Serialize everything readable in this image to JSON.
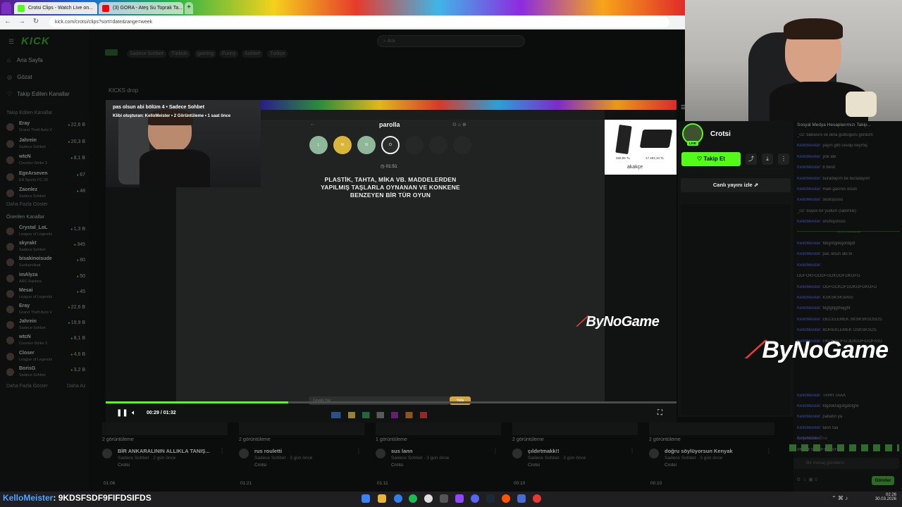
{
  "browser": {
    "tabs": [
      {
        "label": "Crotsi Clips - Watch Live on..."
      },
      {
        "label": "(3) GORA - Ateş Su Toprak Ta..."
      }
    ],
    "url": "kick.com/crotsi/clips?sort=date&range=week"
  },
  "kick": {
    "logo": "KICK",
    "search_placeholder": "Ara",
    "nav": [
      {
        "label": "Ana Sayfa",
        "icon": "home-icon"
      },
      {
        "label": "Gözat",
        "icon": "compass-icon"
      },
      {
        "label": "Takip Edilen Kanallar",
        "icon": "heart-icon"
      }
    ],
    "followed_header": "Takip Edilen Kanallar",
    "followed": [
      {
        "name": "Eray",
        "game": "Grand Theft Auto V",
        "viewers": "22,6 B"
      },
      {
        "name": "Jahrein",
        "game": "Sadece Sohbet",
        "viewers": "20,3 B"
      },
      {
        "name": "wtcN",
        "game": "Counter-Strike 2",
        "viewers": "8,1 B"
      },
      {
        "name": "EgeArseven",
        "game": "EA Sports FC 26",
        "viewers": "67"
      },
      {
        "name": "Zaonlez",
        "game": "Sadece Sohbet",
        "viewers": "48"
      }
    ],
    "show_more_1": "Daha Fazla Göster",
    "recommended_header": "Önerilen Kanallar",
    "recommended": [
      {
        "name": "Crystal_LoL",
        "game": "League of Legends",
        "viewers": "1,3 B"
      },
      {
        "name": "skyrakt",
        "game": "Sadece Sohbet",
        "viewers": "345"
      },
      {
        "name": "bisakinoisude",
        "game": "Sunkarolinat",
        "viewers": "80"
      },
      {
        "name": "imAlyza",
        "game": "ARC Raiders",
        "viewers": "50"
      },
      {
        "name": "Mesai",
        "game": "League of Legends",
        "viewers": "45"
      },
      {
        "name": "Eray",
        "game": "Grand Theft Auto V",
        "viewers": "22,6 B"
      },
      {
        "name": "Jahrein",
        "game": "Sadece Sohbet",
        "viewers": "19,9 B"
      },
      {
        "name": "wtcN",
        "game": "Counter-Strike 2",
        "viewers": "8,1 B"
      },
      {
        "name": "Closer",
        "game": "League of Legends",
        "viewers": "4,6 B"
      },
      {
        "name": "BorisG",
        "game": "Sadece Sohbet",
        "viewers": "3,2 B"
      }
    ],
    "show_more_2": "Daha Fazla Göster",
    "show_less": "Daha Az",
    "tags": [
      "Sadece Sohbet",
      "Türkish",
      "gaming",
      "Funny",
      "Sohbet",
      "Türkçe"
    ],
    "section_title": "KICKS drop"
  },
  "player": {
    "clip_title": "pas olsun abi bölüm 4 • Sadece Sohbet",
    "clip_sub": "Klibi oluşturan: KelloMeister • 2 Görüntüleme • 1 saat önce",
    "time": "00:29 / 01:32",
    "progress_fraction": 0.32,
    "game": {
      "title": "parolla",
      "letters": [
        "L",
        "M",
        "N",
        "O",
        "",
        "",
        ""
      ],
      "timer": "01:51",
      "question": "PLASTİK, TAHTA, MİKA VB. MADDELERDEN YAPILMIŞ TAŞLARLA OYNANAN VE KONKENE BENZEYEN BİR TÜR OYUN",
      "answer_placeholder": "Cevabı Yaz",
      "answer_button": "Yolla"
    },
    "ad": {
      "brand": "akakçe",
      "price1": "268,99 TL",
      "price2": "17.493,10 TL"
    },
    "watermark": "ByNoGame"
  },
  "channel": {
    "name": "Crotsi",
    "live_badge": "LIVE",
    "follow_label": "Takip Et",
    "watch_live": "Canlı yayını izle"
  },
  "chat": {
    "pinned": "Sosyal Medya Hesaplarımızı Takip...",
    "messages": [
      {
        "user": "",
        "text": "_02: babasını ile defa gulduguru gördüm"
      },
      {
        "user": "KelloMeister:",
        "text": "yayın gitti cevap neymiş"
      },
      {
        "user": "KelloMeister:",
        "text": "yok abi"
      },
      {
        "user": "KelloMeister:",
        "text": "b bestl"
      },
      {
        "user": "KelloMeister:",
        "text": "buradayım be buradayım"
      },
      {
        "user": "KelloMeister:",
        "text": "Hadi gacmis olsun"
      },
      {
        "user": "KelloMeister:",
        "text": "sksksjssso"
      },
      {
        "user": "",
        "text": "_02: büyük bir yudum (tadımlık)"
      },
      {
        "user": "KelloMeister:",
        "text": "shshsjsbsxs"
      },
      {
        "user": "",
        "text": "Yeni mesajlar"
      },
      {
        "user": "KelloMeister:",
        "text": "fdkgnfgdkgofdgdf"
      },
      {
        "user": "KelloMeister:",
        "text": "pas olsun abi bi"
      },
      {
        "user": "KelloMeister:",
        "text": ""
      },
      {
        "user": "",
        "text": "ODFOKFOODFGDKGOFDKOFG"
      },
      {
        "user": "KelloMeister:",
        "text": "ODFGCKOFGOKOFGKGFD"
      },
      {
        "user": "KelloMeister:",
        "text": "KSKSKSKSPAS"
      },
      {
        "user": "KelloMeister:",
        "text": "fdgfghjgfhejghf"
      },
      {
        "user": "KelloMeister:",
        "text": "GECELEMEK SKSKSKSOSOS"
      },
      {
        "user": "KelloMeister:",
        "text": "BÖREKLEMEK OSKSKSOS"
      },
      {
        "user": "KelloMeister:",
        "text": "GKOFGOFG:3DIGOFIGOFIGO"
      },
      {
        "user": "",
        "text": ""
      },
      {
        "user": "",
        "text": ""
      },
      {
        "user": "",
        "text": ""
      },
      {
        "user": "",
        "text": ""
      },
      {
        "user": "KelloMeister:",
        "text": "TAHH TAAA"
      },
      {
        "user": "KelloMeister:",
        "text": "kfgdokfagofgdofgfd"
      },
      {
        "user": "KelloMeister:",
        "text": "patlatın ya"
      },
      {
        "user": "KelloMeister:",
        "text": "tanrı taa"
      },
      {
        "user": "KelloMeister:",
        "text": ""
      },
      {
        "user": "",
        "text": "9KDSFSDF9FIFDSIFDS"
      }
    ],
    "send_placeholder": "Bir mesaj gönderin",
    "send_button": "Gönder",
    "settings": "Seçenekler Öne"
  },
  "clips": [
    {
      "views": "2 görüntüleme",
      "title": "BİR ANKARALININ ALLIKLA TANIŞ...",
      "cat": "Sadece Sohbet · 2 gün önce",
      "author": "Crotsi",
      "dur": "01:06"
    },
    {
      "views": "2 görüntüleme",
      "title": "rus rouletti",
      "cat": "Sadece Sohbet · 3 gün önce",
      "author": "Crotsi",
      "dur": "01:21"
    },
    {
      "views": "1 görüntüleme",
      "title": "sus lann",
      "cat": "Sadece Sohbet · 3 gün önce",
      "author": "Crotsi",
      "dur": "01:11"
    },
    {
      "views": "2 görüntüleme",
      "title": "çıldırtmakk!!",
      "cat": "Sadece Sohbet · 3 gün önce",
      "author": "Crotsi",
      "dur": "00:10"
    },
    {
      "views": "2 görüntüleme",
      "title": "doğru söylüyorsun Kenyak",
      "cat": "Sadece Sohbet · 3 gün önce",
      "author": "Crotsi",
      "dur": "00:10"
    }
  ],
  "overlay": {
    "user": "KelloMeister",
    "message": ": 9KDSFSDF9FIFDSIFDS"
  },
  "taskbar": {
    "time": "02:26",
    "date": "30.03.2026"
  }
}
